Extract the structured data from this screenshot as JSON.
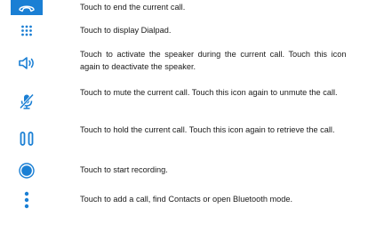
{
  "accent_color": "#1a7fd4",
  "rows": [
    {
      "icon": "end-call-icon",
      "text": "Touch to end the current call."
    },
    {
      "icon": "dialpad-icon",
      "text": "Touch to display Dialpad."
    },
    {
      "icon": "speaker-icon",
      "text": "Touch to activate the speaker during the current call. Touch this icon again to deactivate the speaker."
    },
    {
      "icon": "mute-microphone-icon",
      "text": "Touch to mute the current call. Touch this icon again to unmute the call."
    },
    {
      "icon": "hold-icon",
      "text": "Touch to hold the current call. Touch this icon again to retrieve the call."
    },
    {
      "icon": "record-icon",
      "text": "Touch to start recording."
    },
    {
      "icon": "more-options-icon",
      "text": "Touch to add a call, find Contacts or open Bluetooth mode."
    }
  ]
}
